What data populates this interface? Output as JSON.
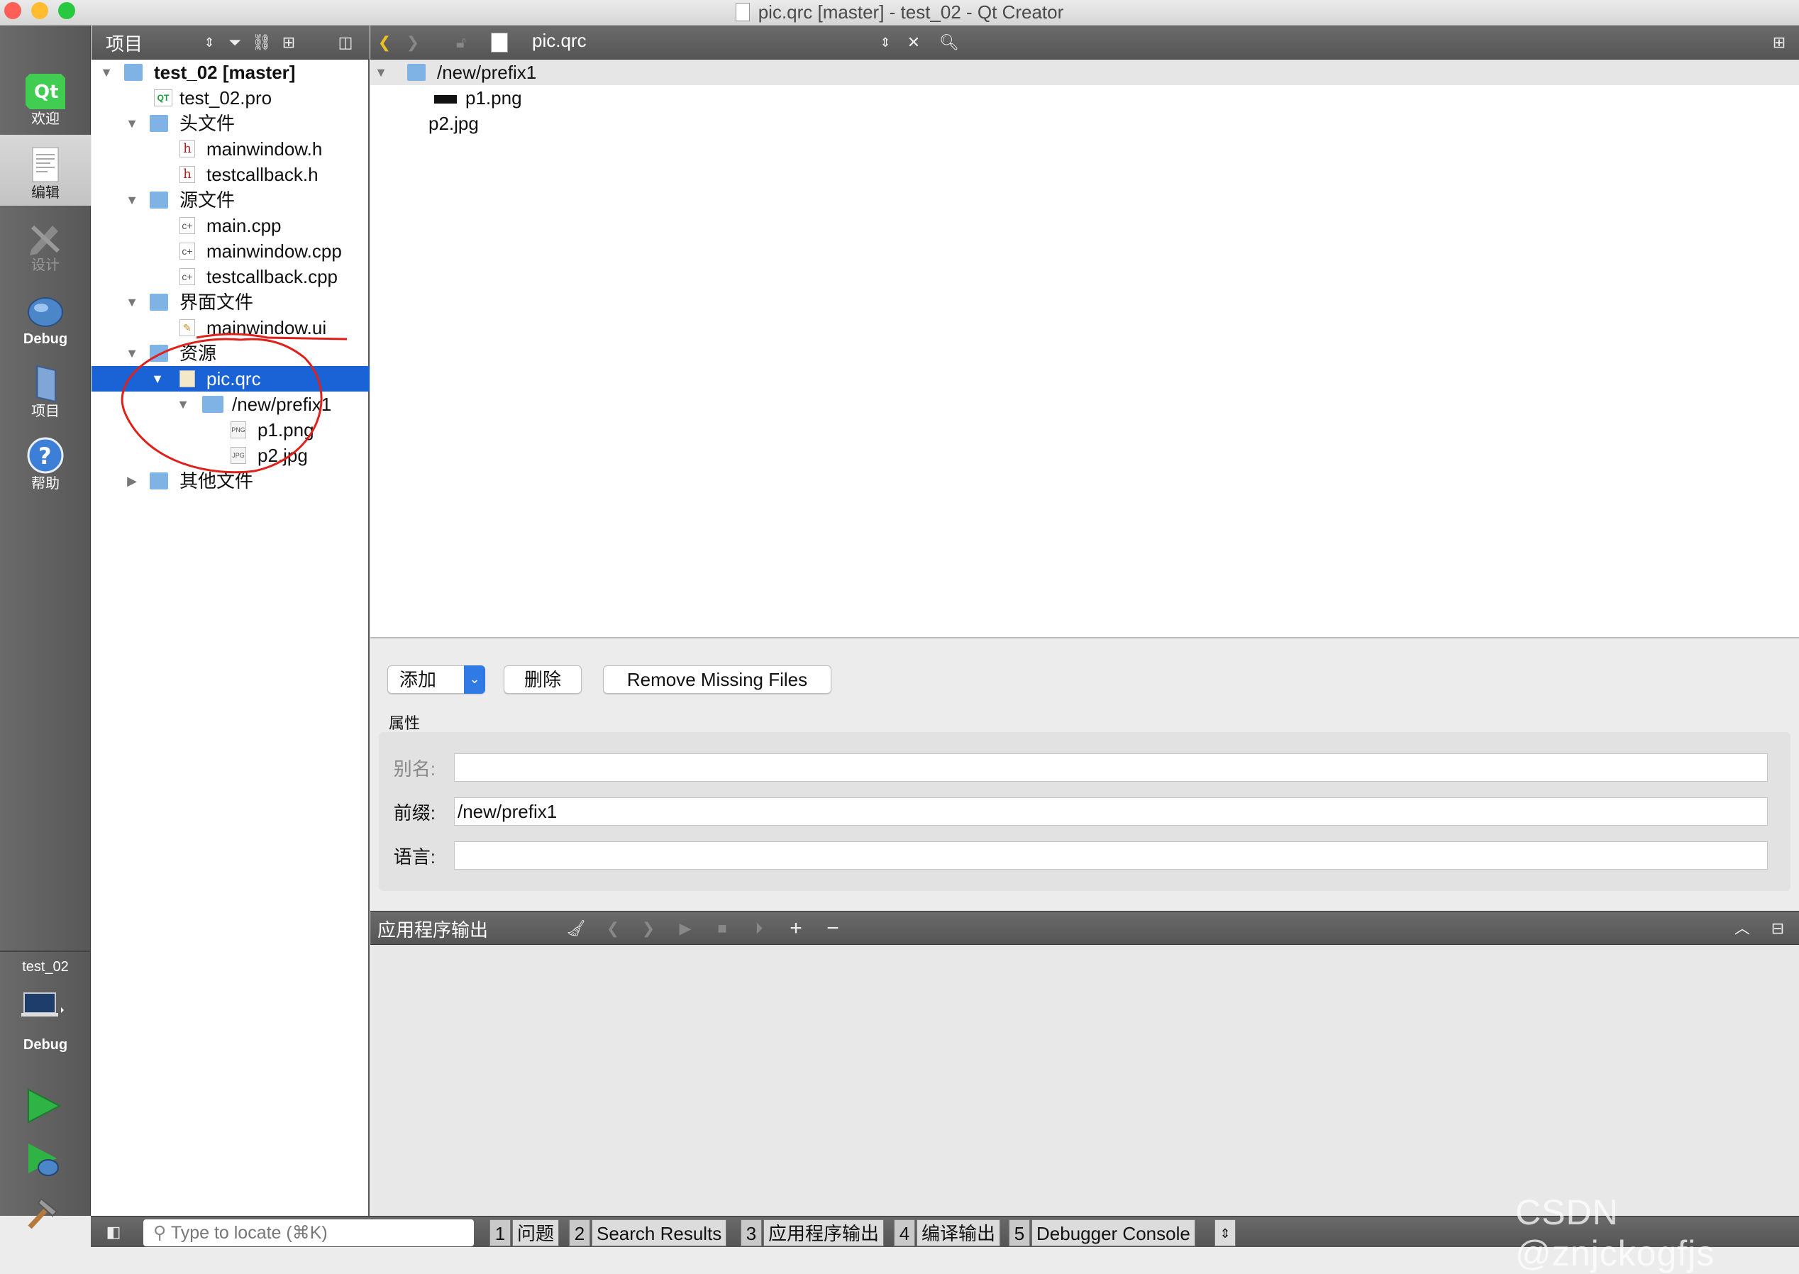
{
  "window": {
    "title": "pic.qrc [master] - test_02 - Qt Creator"
  },
  "modes": [
    {
      "label": "欢迎",
      "icon": "qt-logo-icon"
    },
    {
      "label": "编辑",
      "icon": "edit-document-icon"
    },
    {
      "label": "设计",
      "icon": "design-pencil-icon"
    },
    {
      "label": "Debug",
      "icon": "debug-bug-icon"
    },
    {
      "label": "项目",
      "icon": "project-book-icon"
    },
    {
      "label": "帮助",
      "icon": "help-icon"
    }
  ],
  "kit": {
    "project": "test_02",
    "build": "Debug"
  },
  "sidebar": {
    "header_label": "项目",
    "tree": [
      {
        "label": "test_02 [master]",
        "bold": true
      },
      {
        "label": "test_02.pro"
      },
      {
        "label": "头文件"
      },
      {
        "label": "mainwindow.h"
      },
      {
        "label": "testcallback.h"
      },
      {
        "label": "源文件"
      },
      {
        "label": "main.cpp"
      },
      {
        "label": "mainwindow.cpp"
      },
      {
        "label": "testcallback.cpp"
      },
      {
        "label": "界面文件"
      },
      {
        "label": "mainwindow.ui"
      },
      {
        "label": "资源"
      },
      {
        "label": "pic.qrc",
        "selected": true
      },
      {
        "label": "/new/prefix1"
      },
      {
        "label": "p1.png"
      },
      {
        "label": "p2.jpg"
      },
      {
        "label": "其他文件"
      }
    ]
  },
  "editor": {
    "open_file": "pic.qrc",
    "resource_tree": [
      {
        "label": "/new/prefix1"
      },
      {
        "label": "p1.png"
      },
      {
        "label": "p2.jpg"
      }
    ],
    "buttons": {
      "add": "添加",
      "remove": "删除",
      "remove_missing": "Remove Missing Files"
    },
    "properties": {
      "title": "属性",
      "alias_label": "别名:",
      "alias_value": "",
      "prefix_label": "前缀:",
      "prefix_value": "/new/prefix1",
      "language_label": "语言:",
      "language_value": ""
    }
  },
  "output_pane": {
    "title": "应用程序输出"
  },
  "status_bar": {
    "locate_placeholder": "Type to locate (⌘K)",
    "tabs": [
      {
        "num": "1",
        "label": "问题"
      },
      {
        "num": "2",
        "label": "Search Results"
      },
      {
        "num": "3",
        "label": "应用程序输出"
      },
      {
        "num": "4",
        "label": "编译输出"
      },
      {
        "num": "5",
        "label": "Debugger Console"
      }
    ]
  },
  "watermark": "CSDN @znjckogfjs",
  "colors": {
    "selection": "#1a63d6",
    "annotation": "#e0201a",
    "run_green": "#2fb344"
  }
}
